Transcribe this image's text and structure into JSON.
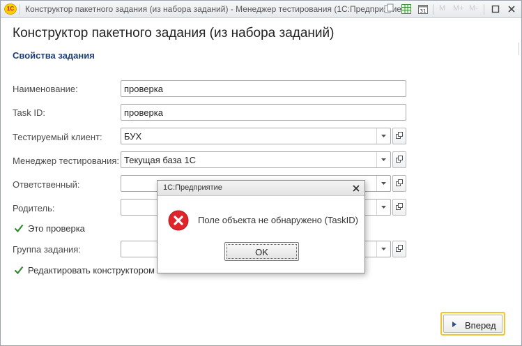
{
  "window": {
    "title": "Конструктор пакетного задания (из набора заданий)  - Менеджер тестирования (1С:Предприятие)",
    "logo_text": "1С",
    "icons": [
      "copy-icon",
      "spreadsheet-icon",
      "calendar-icon",
      "memory-m-icon",
      "memory-mplus-icon",
      "memory-mminus-icon"
    ],
    "memory_labels": [
      "M",
      "M+",
      "M-"
    ],
    "controls": [
      "maximize-icon",
      "close-icon"
    ]
  },
  "form": {
    "title": "Конструктор пакетного задания (из набора заданий)",
    "section": "Свойства задания",
    "fields": {
      "name": {
        "label": "Наименование:",
        "value": "проверка"
      },
      "task_id": {
        "label": "Task ID:",
        "value": "проверка"
      },
      "client": {
        "label": "Тестируемый клиент:",
        "value": "БУХ"
      },
      "manager": {
        "label": "Менеджер тестирования:",
        "value": "Текущая база 1С"
      },
      "responsible": {
        "label": "Ответственный:",
        "value": ""
      },
      "parent": {
        "label": "Родитель:",
        "value": ""
      },
      "group": {
        "label": "Группа задания:",
        "value": ""
      }
    },
    "checkboxes": {
      "is_check": {
        "label": "Это проверка",
        "checked": true
      },
      "edit_constructor": {
        "label": "Редактировать конструктором",
        "checked": true
      }
    },
    "next_button": "Вперед"
  },
  "dialog": {
    "title": "1С:Предприятие",
    "message": "Поле объекта не обнаружено (TaskID)",
    "ok": "OK",
    "icon": "error-icon"
  },
  "colors": {
    "section_title": "#1f3d7a",
    "error_red": "#e0242b",
    "check_green": "#2e8b2e",
    "default_button_border": "#f0c43a"
  }
}
